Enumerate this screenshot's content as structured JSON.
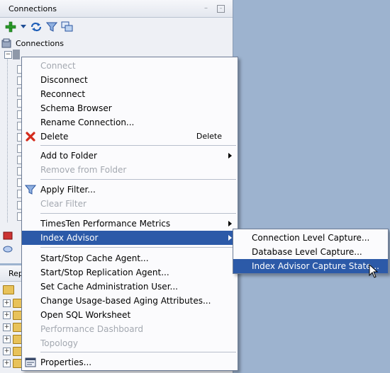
{
  "connections_panel": {
    "title": "Connections",
    "minimize_glyph": "–",
    "close_glyph": "✕",
    "root_label": "Connections",
    "toolbar_icons": [
      "add-connection-icon",
      "dropdown-arrow-icon",
      "refresh-icon",
      "filter-icon",
      "schema-icon"
    ]
  },
  "reports_panel": {
    "title": "Rep"
  },
  "context_menu": {
    "items": [
      {
        "label": "Connect",
        "disabled": true
      },
      {
        "label": "Disconnect"
      },
      {
        "label": "Reconnect"
      },
      {
        "label": "Schema Browser"
      },
      {
        "label": "Rename Connection..."
      },
      {
        "label": "Delete",
        "shortcut": "Delete",
        "icon": "delete-x-icon"
      },
      {
        "label": "Add to Folder",
        "submenu": true
      },
      {
        "label": "Remove from Folder",
        "disabled": true
      },
      {
        "label": "Apply Filter...",
        "icon": "filter-icon"
      },
      {
        "label": "Clear Filter",
        "disabled": true
      },
      {
        "label": "TimesTen Performance Metrics",
        "submenu": true
      },
      {
        "label": "Index Advisor",
        "submenu": true,
        "selected": true
      },
      {
        "label": "Start/Stop Cache Agent..."
      },
      {
        "label": "Start/Stop Replication Agent..."
      },
      {
        "label": "Set Cache Administration User..."
      },
      {
        "label": "Change Usage-based Aging Attributes..."
      },
      {
        "label": "Open SQL Worksheet"
      },
      {
        "label": "Performance Dashboard",
        "disabled": true
      },
      {
        "label": "Topology",
        "disabled": true
      },
      {
        "label": "Properties...",
        "icon": "properties-icon"
      }
    ]
  },
  "submenu": {
    "items": [
      {
        "label": "Connection Level Capture..."
      },
      {
        "label": "Database Level Capture..."
      },
      {
        "label": "Index Advisor Capture State...",
        "selected": true
      }
    ]
  },
  "colors": {
    "background": "#9db3cf",
    "selection": "#2c5aa8",
    "disabled_text": "#a3a8b0"
  }
}
